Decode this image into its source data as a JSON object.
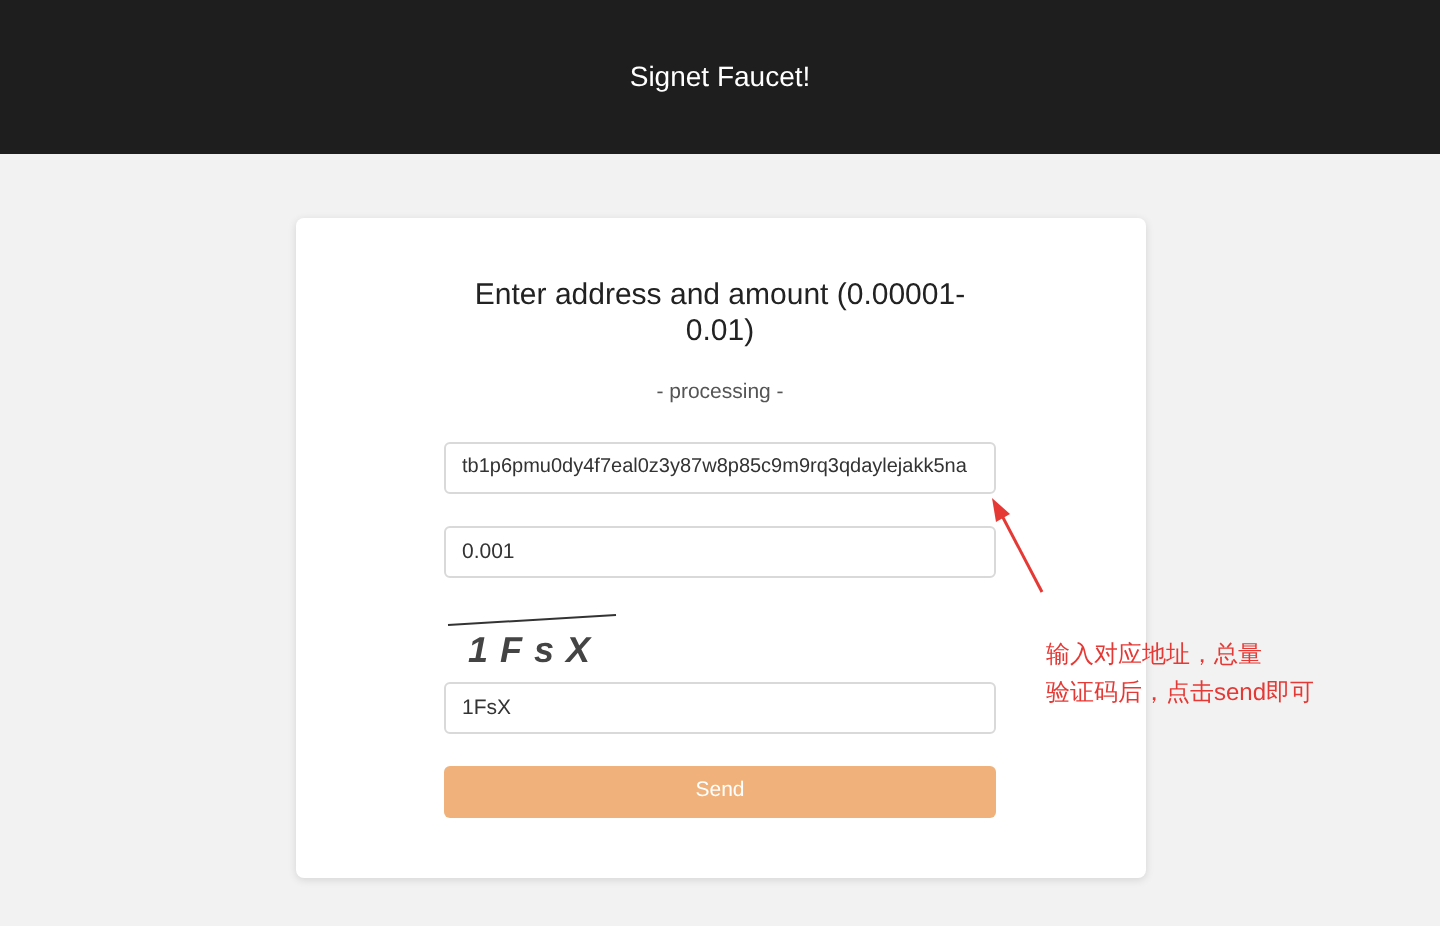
{
  "header": {
    "title": "Signet Faucet!"
  },
  "card": {
    "heading": "Enter address and amount (0.00001-0.01)",
    "status": "- processing -",
    "address_field": {
      "value": "tb1p6pmu0dy4f7eal0z3y87w8p85c9m9rq3qdaylejakk5na"
    },
    "amount_field": {
      "value": "0.001"
    },
    "captcha": {
      "text": "1FsX"
    },
    "captcha_field": {
      "value": "1FsX"
    },
    "send_button": {
      "label": "Send",
      "disabled": true
    }
  },
  "annotation": {
    "lines": [
      "输入对应地址，总量",
      "验证码后，点击send即可"
    ]
  }
}
